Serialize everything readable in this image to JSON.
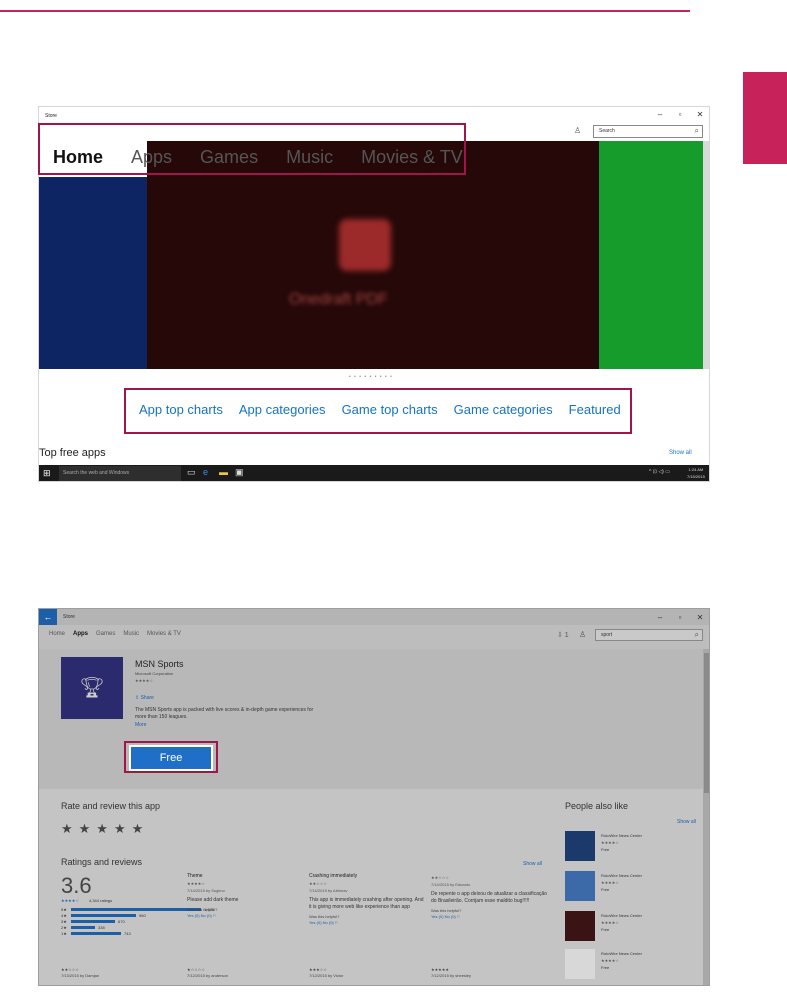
{
  "colors": {
    "accent": "#c8225a",
    "link_blue": "#1673c6",
    "highlight_border": "#a0154a"
  },
  "store_home": {
    "window_title": "Store",
    "window_controls": [
      "–",
      "▫",
      "✕"
    ],
    "search_placeholder": "Search",
    "nav": [
      "Home",
      "Apps",
      "Games",
      "Music",
      "Movies & TV"
    ],
    "hero_blurred_title": "Onedraft PDF",
    "carousel_dots": "• • • • • • • • •",
    "category_links": [
      "App top charts",
      "App categories",
      "Game top charts",
      "Game categories",
      "Featured"
    ],
    "section_title": "Top free apps",
    "show_all": "Show all",
    "taskbar": {
      "search_text": "Search the web and Windows",
      "tray_text": "^ ⊡ ◁) ▭",
      "clock_time": "1:24 AM",
      "clock_date": "7/15/2015"
    }
  },
  "app_page": {
    "window_title": "Store",
    "window_controls": [
      "–",
      "▫",
      "✕"
    ],
    "back_icon": "←",
    "nav": [
      "Home",
      "Apps",
      "Games",
      "Music",
      "Movies & TV"
    ],
    "download_indicator": "⇩ 1",
    "search_value": "sport",
    "app": {
      "name": "MSN Sports",
      "publisher": "Microsoft Corporation",
      "stars": "★★★★☆",
      "share": "Share",
      "description": "The MSN Sports app is packed with live scores & in-depth game experiences for more than 150 leagues.",
      "more": "More",
      "install_button": "Free"
    },
    "rate_section_title": "Rate and review this app",
    "rate_stars": "★★★★★",
    "reviews_section_title": "Ratings and reviews",
    "reviews_show_all": "Show all",
    "rating_value": "3.6",
    "rating_stars": "★★★★☆",
    "rating_count": "4,344 ratings",
    "rating_bars": [
      {
        "label": "5★",
        "value": "1,925",
        "fraction": 0.44
      },
      {
        "label": "4★",
        "value": "960",
        "fraction": 0.22
      },
      {
        "label": "3★",
        "value": "670",
        "fraction": 0.15
      },
      {
        "label": "2★",
        "value": "338",
        "fraction": 0.08
      },
      {
        "label": "1★",
        "value": "743",
        "fraction": 0.17
      }
    ],
    "reviews": [
      {
        "title": "Theme",
        "stars": "★★★★☆",
        "meta": "7/14/2015 by Sugimo",
        "body": "Please add dark theme",
        "helpful": "Was this helpful?",
        "votes": "Yes (0)     No (0)   ⚐"
      },
      {
        "title": "Crashing immediately",
        "stars": "★★☆☆☆",
        "meta": "7/14/2015 by Abhinav",
        "body": "This app is immediately crashing after opening. And it is giving more web like experience than app",
        "helpful": "Was this helpful?",
        "votes": "Yes (0)     No (0)   ⚐"
      },
      {
        "title": "",
        "stars": "★★☆☆☆",
        "meta": "7/14/2015 by Eduardo",
        "body": "De repente o app deixou de atualizar a classificação do Brasileirão. Corrijam esse maldito bug!!!!!",
        "helpful": "Was this helpful?",
        "votes": "Yes (0)     No (0)   ⚐"
      }
    ],
    "bottom_reviews": [
      {
        "stars": "★★☆☆☆",
        "meta": "7/13/2015 by Damjan"
      },
      {
        "stars": "★☆☆☆☆",
        "meta": "7/12/2015 by anderson"
      },
      {
        "stars": "★★★☆☆",
        "meta": "7/12/2015 by Victor"
      },
      {
        "stars": "★★★★★",
        "meta": "7/12/2015 by sheesley"
      }
    ],
    "people_also_like_title": "People also like",
    "people_also_like_show_all": "Show all",
    "people_also_like": [
      {
        "name": "RotoWire News Center",
        "stars": "★★★★☆",
        "price": "Free"
      },
      {
        "name": "RotoWire News Center",
        "stars": "★★★★☆",
        "price": "Free"
      },
      {
        "name": "RotoWire News Center",
        "stars": "★★★★☆",
        "price": "Free"
      },
      {
        "name": "RotoWire News Center",
        "stars": "★★★★☆",
        "price": "Free"
      }
    ]
  }
}
